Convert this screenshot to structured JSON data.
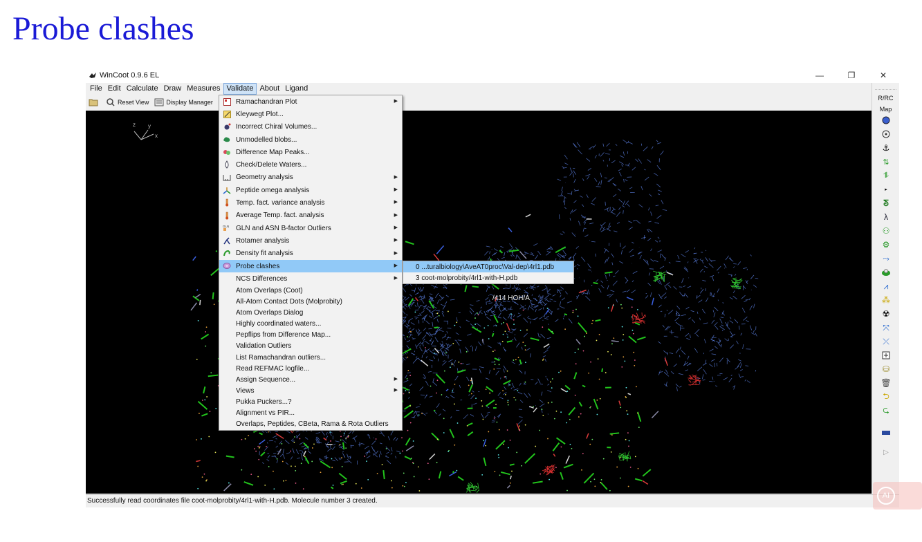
{
  "slide": {
    "title": "Probe clashes"
  },
  "window": {
    "title": "WinCoot 0.9.6 EL",
    "controls": {
      "minimize": "—",
      "maximize": "❐",
      "close": "✕"
    }
  },
  "menubar": [
    {
      "label": "File"
    },
    {
      "label": "Edit"
    },
    {
      "label": "Calculate"
    },
    {
      "label": "Draw"
    },
    {
      "label": "Measures"
    },
    {
      "label": "Validate"
    },
    {
      "label": "About"
    },
    {
      "label": "Ligand"
    }
  ],
  "toolbar": {
    "reset_view": "Reset View",
    "display_manager": "Display Manager"
  },
  "viewport": {
    "axes": {
      "x": "x",
      "y": "y",
      "z": "z"
    },
    "atom_label": "/414 HOH/A"
  },
  "right_toolbar": {
    "rrc": "R/RC",
    "map": "Map"
  },
  "validate_menu": {
    "items": [
      {
        "label": "Ramachandran Plot",
        "submenu": true,
        "icon": "ramachandran-icon"
      },
      {
        "label": "Kleywegt Plot...",
        "submenu": false,
        "icon": "kleywegt-icon"
      },
      {
        "label": "Incorrect Chiral Volumes...",
        "submenu": false,
        "icon": "chiral-icon"
      },
      {
        "label": "Unmodelled blobs...",
        "submenu": false,
        "icon": "blobs-icon"
      },
      {
        "label": "Difference Map Peaks...",
        "submenu": false,
        "icon": "peaks-icon"
      },
      {
        "label": "Check/Delete Waters...",
        "submenu": false,
        "icon": "water-drop-icon"
      },
      {
        "label": "Geometry analysis",
        "submenu": true,
        "icon": "geometry-icon"
      },
      {
        "label": "Peptide omega analysis",
        "submenu": true,
        "icon": "omega-icon"
      },
      {
        "label": "Temp. fact. variance analysis",
        "submenu": true,
        "icon": "thermometer-icon"
      },
      {
        "label": "Average Temp. fact. analysis",
        "submenu": true,
        "icon": "thermometer-icon"
      },
      {
        "label": "GLN and ASN B-factor Outliers",
        "submenu": true,
        "icon": "bfactor-icon"
      },
      {
        "label": "Rotamer analysis",
        "submenu": true,
        "icon": "rotamer-icon"
      },
      {
        "label": "Density fit analysis",
        "submenu": true,
        "icon": "density-icon"
      },
      {
        "label": "Probe clashes",
        "submenu": true,
        "icon": "probe-icon",
        "highlight": true
      },
      {
        "label": "NCS Differences",
        "submenu": true,
        "icon": ""
      }
    ],
    "plain_items": [
      "Atom Overlaps (Coot)",
      "All-Atom Contact Dots (Molprobity)",
      "Atom Overlaps Dialog",
      "Highly coordinated waters...",
      "Pepflips from Difference Map...",
      "Validation Outliers",
      "List Ramachandran outliers...",
      "Read REFMAC logfile...",
      "Assign Sequence...",
      "Views",
      "Pukka Puckers...?",
      "Alignment vs PIR...",
      "Overlaps, Peptides, CBeta, Rama & Rota Outliers"
    ],
    "plain_submenu_flags": [
      false,
      false,
      false,
      false,
      false,
      false,
      false,
      false,
      true,
      true,
      false,
      false,
      false
    ]
  },
  "probe_submenu": {
    "items": [
      {
        "label": "0 ...turalbiology\\AveAT0proc\\Val-dep\\4rl1.pdb",
        "highlight": true
      },
      {
        "label": "3 coot-molprobity/4rl1-with-H.pdb",
        "highlight": false
      }
    ]
  },
  "status": {
    "text": "Successfully read coordinates file coot-molprobity/4rl1-with-H.pdb.  Molecule number 3 created."
  },
  "watermark": {
    "text": "AI"
  },
  "colors": {
    "title": "#1a1ad6",
    "highlight": "#91c9f7",
    "viewport_bg": "#000000",
    "mesh_blue": "#5b7fe0",
    "carbon_green": "#22c41c"
  }
}
